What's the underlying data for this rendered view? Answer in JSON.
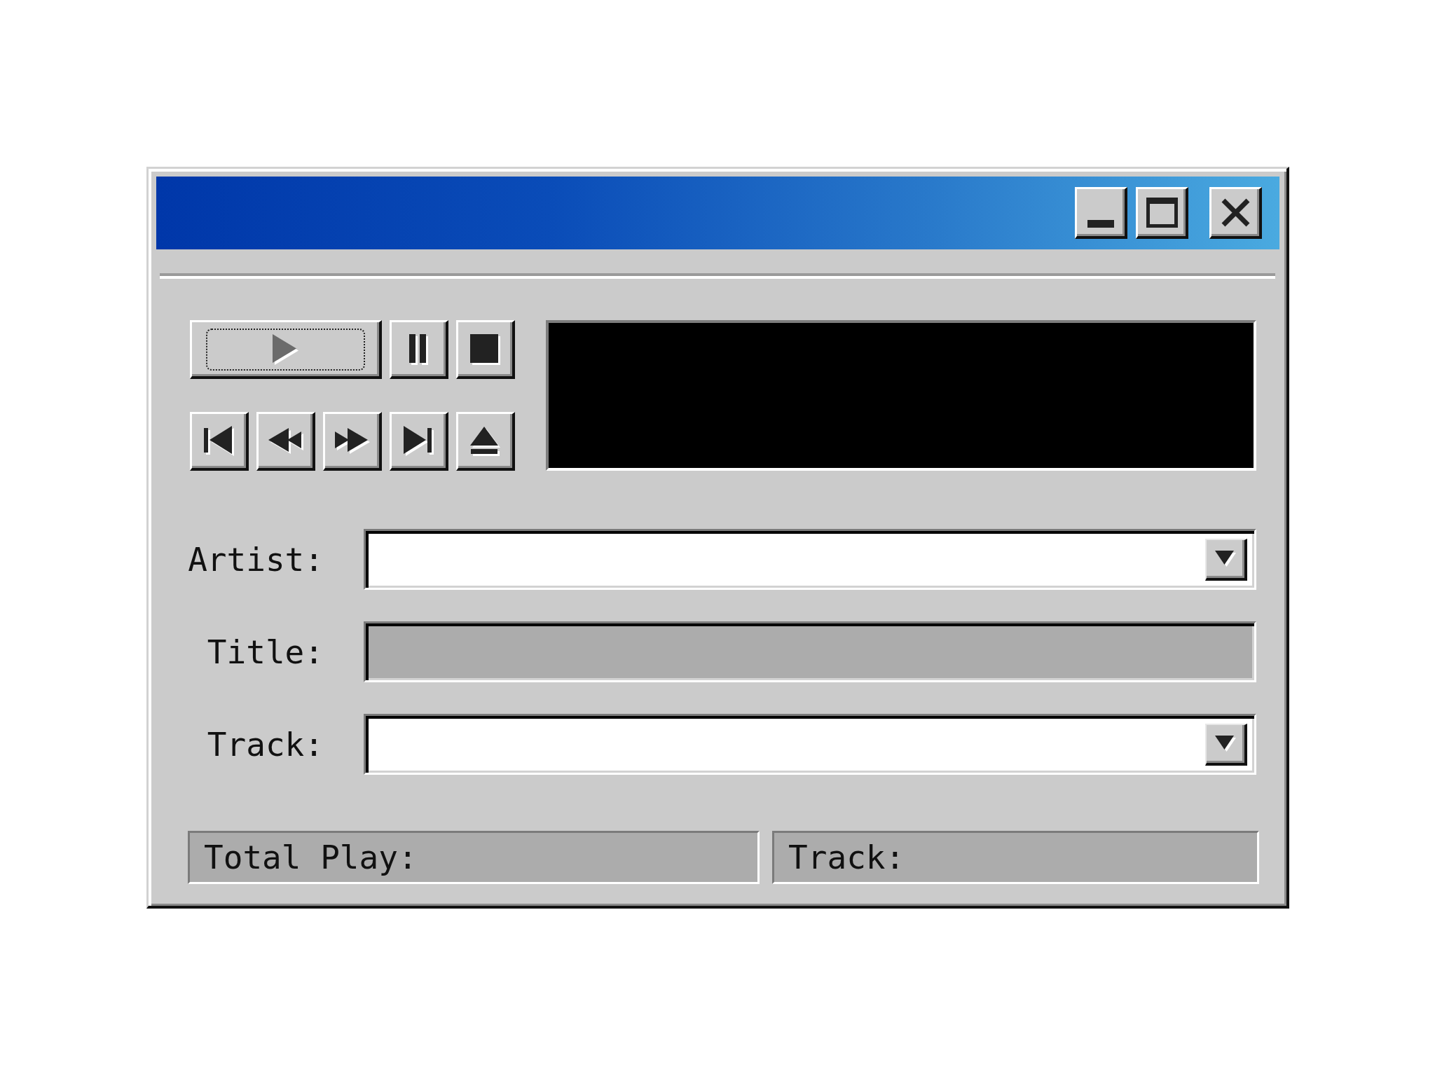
{
  "title_bar": {
    "buttons": [
      {
        "kind": "minimize"
      },
      {
        "kind": "maximize"
      },
      {
        "kind": "close"
      }
    ]
  },
  "transport": {
    "rows": [
      {
        "buttons": [
          {
            "kind": "play",
            "focused": true
          },
          {
            "kind": "pause",
            "focused": false
          },
          {
            "kind": "stop",
            "focused": false
          }
        ]
      },
      {
        "buttons": [
          {
            "kind": "previous",
            "focused": false
          },
          {
            "kind": "rewind",
            "focused": false
          },
          {
            "kind": "fast_forward",
            "focused": false
          },
          {
            "kind": "next",
            "focused": false
          },
          {
            "kind": "eject",
            "focused": false
          }
        ]
      }
    ]
  },
  "fields": [
    {
      "label": "Artist:",
      "kind": "dropdown",
      "disabled": false
    },
    {
      "label": "Title:",
      "kind": "text",
      "disabled": true
    },
    {
      "label": "Track:",
      "kind": "dropdown",
      "disabled": false
    }
  ],
  "status_bar": [
    {
      "label": "Total Play:"
    },
    {
      "label": "Track:"
    }
  ]
}
